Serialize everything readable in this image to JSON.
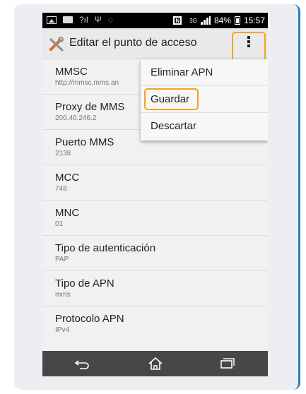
{
  "status_bar": {
    "battery": "84%",
    "time": "15:57",
    "network_type": "3G",
    "icons": [
      "image-icon",
      "message-icon",
      "signal-icon",
      "usb-icon",
      "alarm-icon",
      "nfc-icon",
      "signal-bars-icon",
      "battery-icon"
    ]
  },
  "action_bar": {
    "title": "Editar el punto de acceso",
    "app_icon": "tools-icon",
    "overflow_icon": "overflow-menu-icon",
    "highlight_color": "#f2a51a"
  },
  "settings": [
    {
      "label": "MMSC",
      "value": "http://mmsc.mms.an"
    },
    {
      "label": "Proxy de MMS",
      "value": "200.40.246.2"
    },
    {
      "label": "Puerto MMS",
      "value": "2138"
    },
    {
      "label": "MCC",
      "value": "748"
    },
    {
      "label": "MNC",
      "value": "01"
    },
    {
      "label": "Tipo de autenticación",
      "value": "PAP"
    },
    {
      "label": "Tipo de APN",
      "value": "mms"
    },
    {
      "label": "Protocolo APN",
      "value": "IPv4"
    }
  ],
  "menu": {
    "items": [
      "Eliminar APN",
      "Guardar",
      "Descartar"
    ],
    "highlighted": "Guardar"
  },
  "nav_bar": {
    "icons": [
      "back-icon",
      "home-icon",
      "recent-apps-icon"
    ]
  }
}
